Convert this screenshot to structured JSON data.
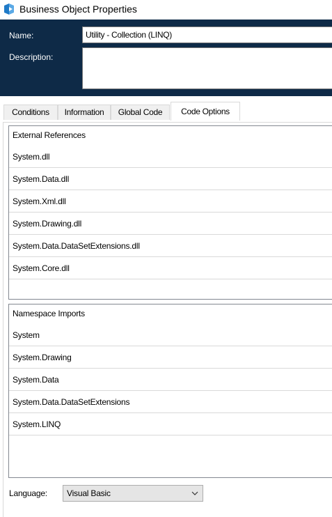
{
  "window": {
    "title": "Business Object Properties",
    "icon": "blueprism-cube-icon"
  },
  "header": {
    "name_label": "Name:",
    "name_value": "Utility - Collection (LINQ)",
    "description_label": "Description:",
    "description_value": ""
  },
  "tabs": [
    {
      "label": "Conditions",
      "active": false
    },
    {
      "label": "Information",
      "active": false
    },
    {
      "label": "Global Code",
      "active": false
    },
    {
      "label": "Code Options",
      "active": true
    }
  ],
  "external_references": {
    "header": "External References",
    "items": [
      "System.dll",
      "System.Data.dll",
      "System.Xml.dll",
      "System.Drawing.dll",
      "System.Data.DataSetExtensions.dll",
      "System.Core.dll",
      ""
    ]
  },
  "namespace_imports": {
    "header": "Namespace Imports",
    "items": [
      "System",
      "System.Drawing",
      "System.Data",
      "System.Data.DataSetExtensions",
      "System.LINQ"
    ]
  },
  "language": {
    "label": "Language:",
    "selected": "Visual Basic"
  },
  "colors": {
    "header_background": "#0e2a47",
    "header_text": "#ffffff",
    "icon_blue": "#1f7ac7"
  }
}
